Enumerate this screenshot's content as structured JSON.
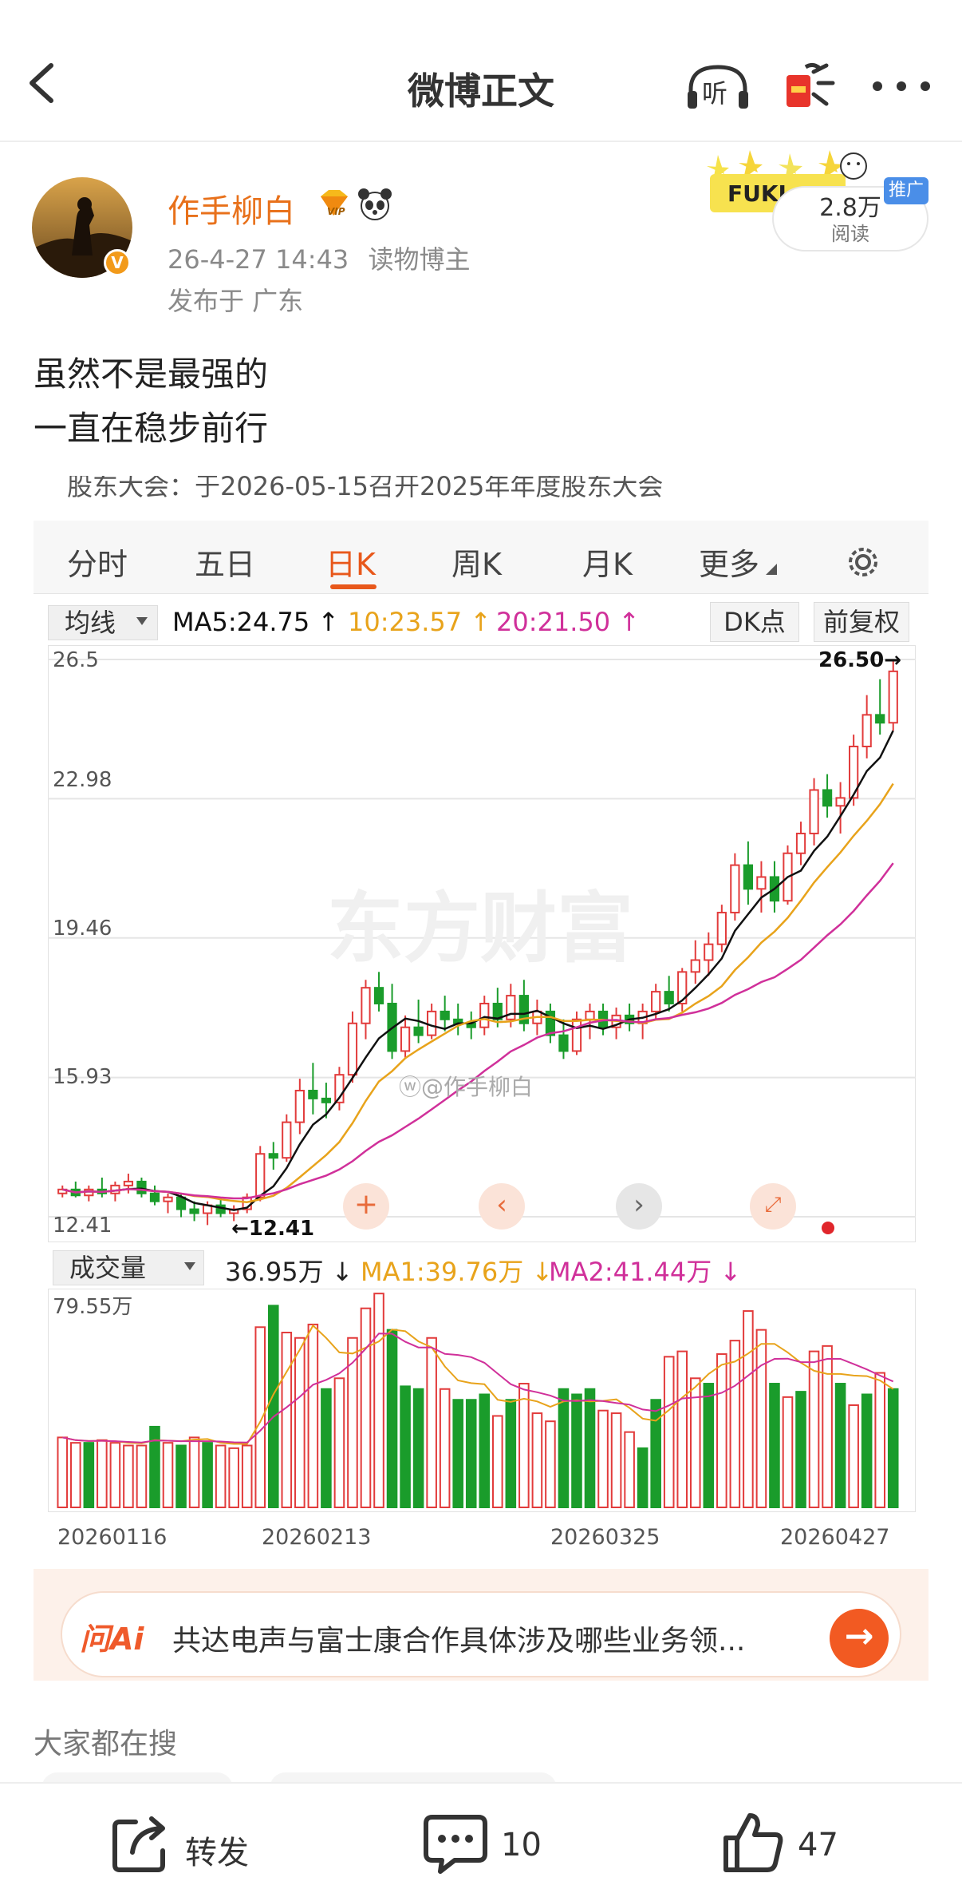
{
  "header": {
    "title": "微博正文",
    "listen_label": "听"
  },
  "author": {
    "name": "作手柳白",
    "vip_label": "VIP",
    "date": "26-4-27 14:43",
    "role": "读物博主",
    "location": "发布于 广东"
  },
  "sticker": {
    "brand": "FUKI",
    "reads": "2.8万",
    "reads_label": "阅读",
    "promo": "推广"
  },
  "post": {
    "line1": "虽然不是最强的",
    "line2": "一直在稳步前行"
  },
  "stock": {
    "banner": "股东大会：于2026-05-15召开2025年年度股东大会",
    "tabs": [
      "分时",
      "五日",
      "日K",
      "周K",
      "月K",
      "更多"
    ],
    "active_tab": 2,
    "ma_select": "均线",
    "ma5": "MA5:24.75",
    "ma10": "10:23.57",
    "ma20": "20:21.50",
    "dk_button": "DK点",
    "adjust_button": "前复权",
    "watermark": "东方财富",
    "weibo_watermark": "@作手柳白",
    "max_label": "26.50",
    "min_label": "12.41",
    "vol_select": "成交量",
    "vol_value": "36.95万",
    "vol_ma1": "MA1:39.76万",
    "vol_ma2": "MA2:41.44万",
    "vol_max": "79.55万",
    "colors": {
      "up": "#e23b3b",
      "down": "#1a9c2b",
      "ma5": "#111111",
      "ma10": "#e8a31b",
      "ma20": "#d0309a"
    }
  },
  "chart_data": [
    {
      "type": "candlestick",
      "title": "",
      "y_ticks": [
        26.5,
        22.98,
        19.46,
        15.93,
        12.41
      ],
      "ylim": [
        12.41,
        26.5
      ],
      "x_ticks": [
        "20260116",
        "20260213",
        "20260325",
        "20260427"
      ],
      "ohlc": [
        [
          13.0,
          13.2,
          12.9,
          13.1
        ],
        [
          13.1,
          13.3,
          12.9,
          12.95
        ],
        [
          12.95,
          13.2,
          12.8,
          13.1
        ],
        [
          13.1,
          13.4,
          12.9,
          13.0
        ],
        [
          13.0,
          13.3,
          12.8,
          13.2
        ],
        [
          13.2,
          13.5,
          13.0,
          13.3
        ],
        [
          13.3,
          13.4,
          12.9,
          13.0
        ],
        [
          13.0,
          13.2,
          12.7,
          12.8
        ],
        [
          12.8,
          13.0,
          12.5,
          12.9
        ],
        [
          12.9,
          13.0,
          12.4,
          12.6
        ],
        [
          12.6,
          12.8,
          12.3,
          12.5
        ],
        [
          12.5,
          12.8,
          12.2,
          12.7
        ],
        [
          12.7,
          12.9,
          12.4,
          12.5
        ],
        [
          12.5,
          12.7,
          12.3,
          12.6
        ],
        [
          12.6,
          13.0,
          12.5,
          12.9
        ],
        [
          12.9,
          14.2,
          12.8,
          14.0
        ],
        [
          14.0,
          14.3,
          13.6,
          13.9
        ],
        [
          13.9,
          15.0,
          13.8,
          14.8
        ],
        [
          14.8,
          15.9,
          14.5,
          15.6
        ],
        [
          15.6,
          16.3,
          15.0,
          15.4
        ],
        [
          15.4,
          15.8,
          14.9,
          15.3
        ],
        [
          15.3,
          16.2,
          15.1,
          16.0
        ],
        [
          16.0,
          17.6,
          15.8,
          17.3
        ],
        [
          17.3,
          18.4,
          16.9,
          18.2
        ],
        [
          18.2,
          18.6,
          17.6,
          17.8
        ],
        [
          17.8,
          18.3,
          16.4,
          16.6
        ],
        [
          16.6,
          17.5,
          16.4,
          17.2
        ],
        [
          17.2,
          17.9,
          16.8,
          17.0
        ],
        [
          17.0,
          17.8,
          16.9,
          17.6
        ],
        [
          17.6,
          18.0,
          17.1,
          17.4
        ],
        [
          17.4,
          17.8,
          17.0,
          17.3
        ],
        [
          17.3,
          17.6,
          16.9,
          17.2
        ],
        [
          17.2,
          18.0,
          17.0,
          17.8
        ],
        [
          17.8,
          18.2,
          17.2,
          17.4
        ],
        [
          17.4,
          18.3,
          17.2,
          18.0
        ],
        [
          18.0,
          18.4,
          17.1,
          17.3
        ],
        [
          17.3,
          17.9,
          17.0,
          17.6
        ],
        [
          17.6,
          17.8,
          16.8,
          17.0
        ],
        [
          17.0,
          17.4,
          16.4,
          16.6
        ],
        [
          16.6,
          17.6,
          16.5,
          17.4
        ],
        [
          17.4,
          17.8,
          16.9,
          17.6
        ],
        [
          17.6,
          17.8,
          17.0,
          17.2
        ],
        [
          17.2,
          17.7,
          16.9,
          17.5
        ],
        [
          17.5,
          17.8,
          17.1,
          17.3
        ],
        [
          17.3,
          17.8,
          16.9,
          17.6
        ],
        [
          17.6,
          18.3,
          17.4,
          18.1
        ],
        [
          18.1,
          18.5,
          17.6,
          17.8
        ],
        [
          17.8,
          18.7,
          17.6,
          18.6
        ],
        [
          18.6,
          19.4,
          18.3,
          18.9
        ],
        [
          18.9,
          19.6,
          18.5,
          19.3
        ],
        [
          19.3,
          20.3,
          19.1,
          20.1
        ],
        [
          20.1,
          21.6,
          19.9,
          21.3
        ],
        [
          21.3,
          21.9,
          20.3,
          20.7
        ],
        [
          20.7,
          21.4,
          20.1,
          21.0
        ],
        [
          21.0,
          21.4,
          20.1,
          20.4
        ],
        [
          20.4,
          21.8,
          20.3,
          21.6
        ],
        [
          21.6,
          22.4,
          21.3,
          22.1
        ],
        [
          22.1,
          23.5,
          21.8,
          23.2
        ],
        [
          23.2,
          23.6,
          22.5,
          22.8
        ],
        [
          22.8,
          23.4,
          22.1,
          23.0
        ],
        [
          23.0,
          24.6,
          22.8,
          24.3
        ],
        [
          24.3,
          25.6,
          24.0,
          25.1
        ],
        [
          25.1,
          26.0,
          24.6,
          24.9
        ],
        [
          24.9,
          26.5,
          24.7,
          26.2
        ]
      ]
    },
    {
      "type": "bar",
      "title": "成交量",
      "ylim": [
        0,
        79.55
      ],
      "values": [
        [
          26,
          1
        ],
        [
          24,
          1
        ],
        [
          24,
          0
        ],
        [
          25,
          1
        ],
        [
          24,
          1
        ],
        [
          23,
          1
        ],
        [
          23,
          1
        ],
        [
          30,
          0
        ],
        [
          24,
          1
        ],
        [
          23,
          0
        ],
        [
          26,
          1
        ],
        [
          24,
          0
        ],
        [
          23,
          1
        ],
        [
          22,
          1
        ],
        [
          23,
          1
        ],
        [
          67,
          1
        ],
        [
          75,
          0
        ],
        [
          65,
          1
        ],
        [
          63,
          1
        ],
        [
          68,
          1
        ],
        [
          44,
          0
        ],
        [
          48,
          1
        ],
        [
          63,
          1
        ],
        [
          74,
          1
        ],
        [
          79.5,
          1
        ],
        [
          66,
          0
        ],
        [
          45,
          0
        ],
        [
          44,
          0
        ],
        [
          63,
          1
        ],
        [
          44,
          1
        ],
        [
          40,
          0
        ],
        [
          40,
          0
        ],
        [
          42,
          0
        ],
        [
          34,
          1
        ],
        [
          40,
          0
        ],
        [
          46,
          1
        ],
        [
          35,
          1
        ],
        [
          32,
          1
        ],
        [
          44,
          0
        ],
        [
          42,
          0
        ],
        [
          44,
          0
        ],
        [
          36,
          1
        ],
        [
          35,
          1
        ],
        [
          28,
          1
        ],
        [
          22,
          0
        ],
        [
          40,
          0
        ],
        [
          56,
          1
        ],
        [
          58,
          1
        ],
        [
          48,
          1
        ],
        [
          46,
          0
        ],
        [
          57,
          1
        ],
        [
          62,
          1
        ],
        [
          73,
          1
        ],
        [
          66,
          1
        ],
        [
          46,
          0
        ],
        [
          41,
          1
        ],
        [
          43,
          0
        ],
        [
          58,
          1
        ],
        [
          60,
          1
        ],
        [
          46,
          0
        ],
        [
          38,
          1
        ],
        [
          42,
          0
        ],
        [
          50,
          1
        ],
        [
          44,
          0
        ]
      ]
    }
  ],
  "search": {
    "title": "大家都在搜"
  },
  "ai": {
    "logo": "问Ai",
    "question": "共达电声与富士康合作具体涉及哪些业务领..."
  },
  "actions": {
    "repost": "转发",
    "comments": "10",
    "likes": "47"
  }
}
